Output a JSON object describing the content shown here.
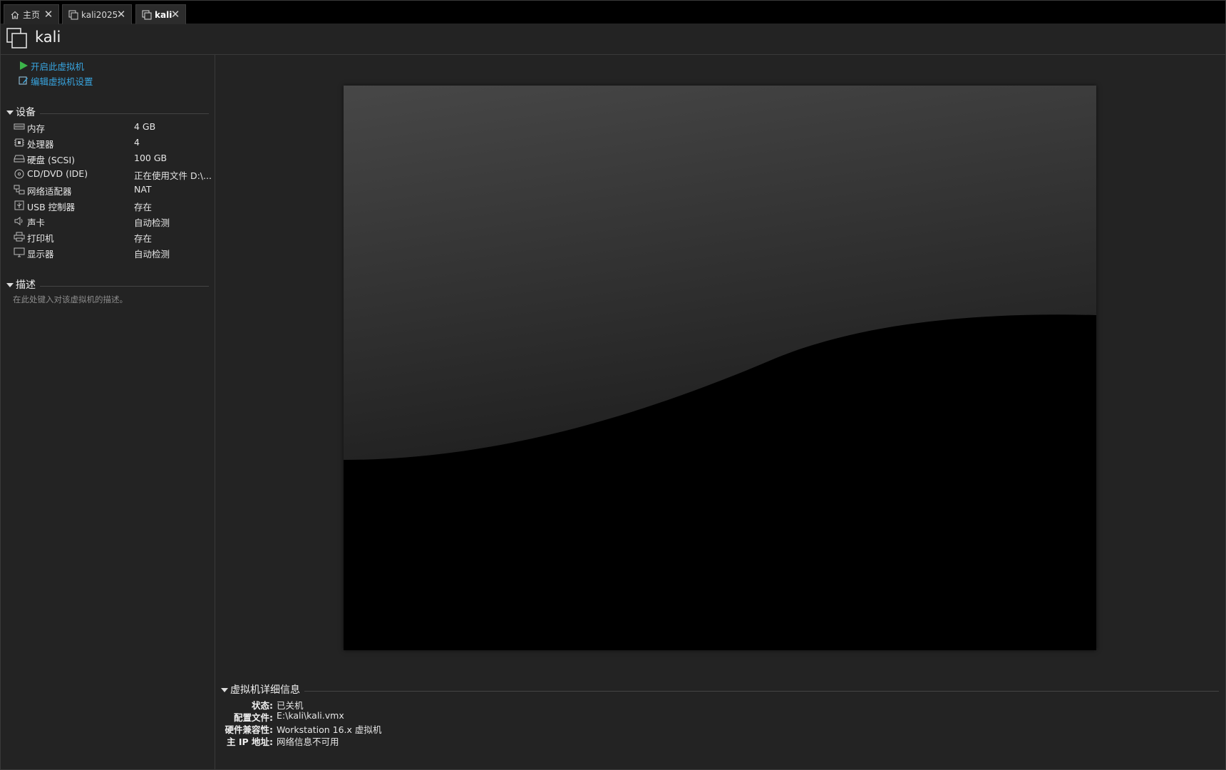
{
  "tabs": [
    {
      "label": "主页",
      "icon": "home-icon",
      "active": false
    },
    {
      "label": "kali2025",
      "icon": "vm-icon",
      "active": false
    },
    {
      "label": "kali",
      "icon": "vm-icon",
      "active": true
    }
  ],
  "vm": {
    "title": "kali"
  },
  "actions": {
    "power_on": "开启此虚拟机",
    "edit_settings": "编辑虚拟机设置"
  },
  "devices": {
    "header": "设备",
    "items": [
      {
        "name": "内存",
        "value": "4 GB",
        "icon": "memory-icon"
      },
      {
        "name": "处理器",
        "value": "4",
        "icon": "cpu-icon"
      },
      {
        "name": "硬盘 (SCSI)",
        "value": "100 GB",
        "icon": "disk-icon"
      },
      {
        "name": "CD/DVD (IDE)",
        "value": "正在使用文件 D:\\...",
        "icon": "cd-icon"
      },
      {
        "name": "网络适配器",
        "value": "NAT",
        "icon": "network-icon"
      },
      {
        "name": "USB 控制器",
        "value": "存在",
        "icon": "usb-icon"
      },
      {
        "name": "声卡",
        "value": "自动检测",
        "icon": "sound-icon"
      },
      {
        "name": "打印机",
        "value": "存在",
        "icon": "printer-icon"
      },
      {
        "name": "显示器",
        "value": "自动检测",
        "icon": "display-icon"
      }
    ]
  },
  "description": {
    "header": "描述",
    "placeholder": "在此处键入对该虚拟机的描述。"
  },
  "details": {
    "header": "虚拟机详细信息",
    "rows": [
      {
        "key": "状态:",
        "value": "已关机"
      },
      {
        "key": "配置文件:",
        "value": "E:\\kali\\kali.vmx"
      },
      {
        "key": "硬件兼容性:",
        "value": "Workstation 16.x 虚拟机"
      },
      {
        "key": "主 IP 地址:",
        "value": "网络信息不可用"
      }
    ]
  },
  "colors": {
    "accent_link": "#38a5e0",
    "play_green": "#3cb44a",
    "background": "#232323"
  }
}
